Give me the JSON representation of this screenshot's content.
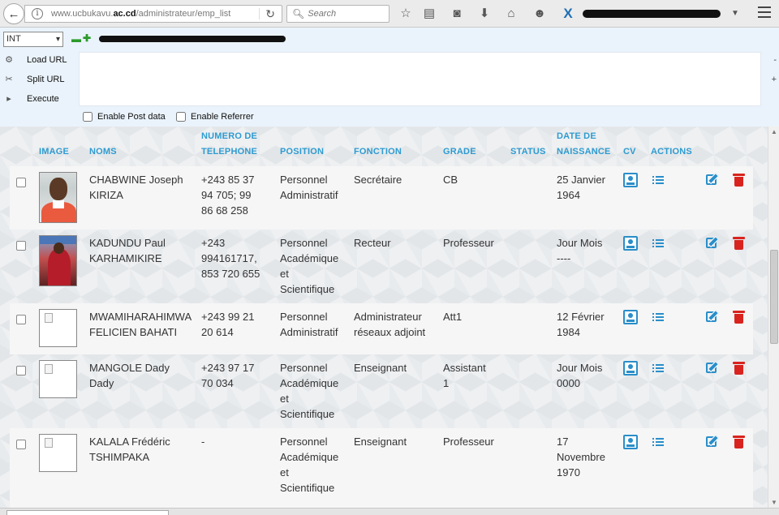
{
  "browser": {
    "url_prefix": "www.ucbukavu.",
    "url_domain": "ac.cd",
    "url_path": "/administrateur/emp_list",
    "search_placeholder": "Search"
  },
  "hackbar": {
    "select_value": "INT",
    "load_url": "Load URL",
    "split_url": "Split URL",
    "execute": "Execute",
    "enable_post": "Enable Post data",
    "enable_referrer": "Enable Referrer",
    "side_minus": "-",
    "side_plus": "+"
  },
  "table": {
    "headers": {
      "image": "IMAGE",
      "noms": "NOMS",
      "telephone_1": "NUMERO DE",
      "telephone_2": "TELEPHONE",
      "position": "POSITION",
      "fonction": "FONCTION",
      "grade": "GRADE",
      "status": "STATUS",
      "date_1": "DATE DE",
      "date_2": "NAISSANCE",
      "cv": "CV",
      "actions": "ACTIONS"
    },
    "rows": [
      {
        "noms": [
          "CHABWINE Joseph",
          "KIRIZA"
        ],
        "telephone": [
          "+243 85 37",
          "94 705; 99",
          "86 68 258"
        ],
        "position": [
          "Personnel",
          "Administratif"
        ],
        "fonction": [
          "Secrétaire"
        ],
        "grade": [
          "CB"
        ],
        "date": [
          "25 Janvier",
          "1964"
        ]
      },
      {
        "noms": [
          "KADUNDU Paul",
          "KARHAMIKIRE"
        ],
        "telephone": [
          "+243",
          "994161717,",
          "853 720 655"
        ],
        "position": [
          "Personnel",
          "Académique",
          "et",
          "Scientifique"
        ],
        "fonction": [
          "Recteur"
        ],
        "grade": [
          "Professeur"
        ],
        "date": [
          "Jour Mois",
          "----"
        ]
      },
      {
        "noms": [
          "MWAMIHARAHIMWA",
          "FELICIEN BAHATI"
        ],
        "telephone": [
          "+243 99 21",
          "20 614"
        ],
        "position": [
          "Personnel",
          "Administratif"
        ],
        "fonction": [
          "Administrateur",
          "réseaux adjoint"
        ],
        "grade": [
          "Att1"
        ],
        "date": [
          "12 Février",
          "1984"
        ]
      },
      {
        "noms": [
          "MANGOLE Dady",
          "Dady"
        ],
        "telephone": [
          "+243 97 17",
          "70 034"
        ],
        "position": [
          "Personnel",
          "Académique",
          "et",
          "Scientifique"
        ],
        "fonction": [
          "Enseignant"
        ],
        "grade": [
          "Assistant",
          "1"
        ],
        "date": [
          "Jour Mois",
          "0000"
        ]
      },
      {
        "noms": [
          "KALALA Frédéric",
          "TSHIMPAKA"
        ],
        "telephone": [
          "-"
        ],
        "position": [
          "Personnel",
          "Académique",
          "et",
          "Scientifique"
        ],
        "fonction": [
          "Enseignant"
        ],
        "grade": [
          "Professeur"
        ],
        "date": [
          "17",
          "Novembre",
          "1970"
        ]
      }
    ]
  },
  "colors": {
    "header_text": "#2e9bd0",
    "action_blue": "#2a8ec9",
    "delete_red": "#d9231e"
  }
}
